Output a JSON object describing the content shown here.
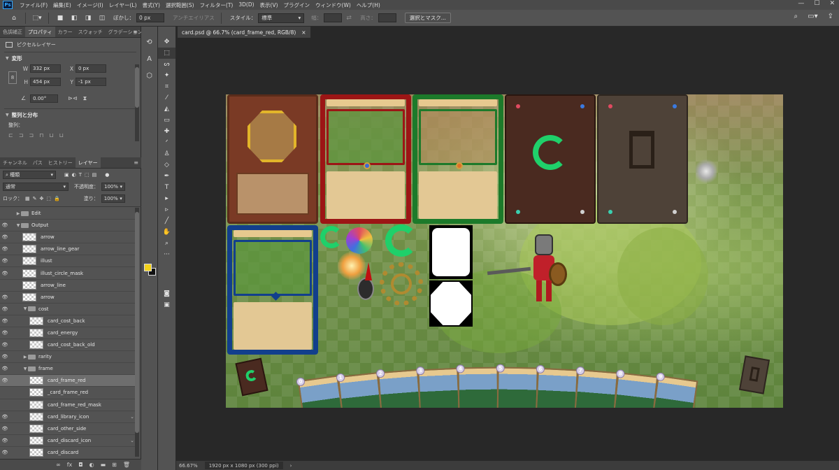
{
  "app": {
    "logo": "Ps"
  },
  "menu": [
    "ファイル(F)",
    "編集(E)",
    "イメージ(I)",
    "レイヤー(L)",
    "書式(Y)",
    "選択範囲(S)",
    "フィルター(T)",
    "3D(D)",
    "表示(V)",
    "プラグイン",
    "ウィンドウ(W)",
    "ヘルプ(H)"
  ],
  "window_controls": {
    "minimize": "—",
    "maximize": "☐",
    "close": "✕"
  },
  "options": {
    "feather_label": "ぼかし：",
    "feather_value": "0 px",
    "antialias_label": "アンチエイリアス",
    "style_label": "スタイル：",
    "style_value": "標準",
    "width_label": "幅：",
    "height_label": "高さ：",
    "select_mask": "選択とマスク..."
  },
  "props_tabs": [
    "色調補正",
    "プロパティ",
    "カラー",
    "スウォッチ",
    "グラデーション",
    "パターン"
  ],
  "properties": {
    "layer_type": "ピクセルレイヤー",
    "transform_title": "変形",
    "w_label": "W",
    "w_value": "332 px",
    "x_label": "X",
    "x_value": "0 px",
    "h_label": "H",
    "h_value": "454 px",
    "y_label": "Y",
    "y_value": "-1 px",
    "angle_value": "0.00°",
    "align_title": "整列と分布",
    "align_label": "整列："
  },
  "layers_tabs": [
    "チャンネル",
    "パス",
    "ヒストリー",
    "レイヤー"
  ],
  "layers_panel": {
    "filter_kind": "種類",
    "blend_mode": "通常",
    "opacity_label": "不透明度：",
    "opacity_value": "100%",
    "lock_label": "ロック：",
    "fill_label": "塗り：",
    "fill_value": "100%"
  },
  "layers": [
    {
      "name": "Edit",
      "kind": "group",
      "depth": 0,
      "visible": false,
      "open": false
    },
    {
      "name": "Output",
      "kind": "group",
      "depth": 0,
      "visible": true,
      "open": true
    },
    {
      "name": "arrow",
      "kind": "layer",
      "depth": 1,
      "visible": true
    },
    {
      "name": "arrow_line_gear",
      "kind": "layer",
      "depth": 1,
      "visible": true
    },
    {
      "name": "illust",
      "kind": "layer",
      "depth": 1,
      "visible": true
    },
    {
      "name": "illust_circle_mask",
      "kind": "layer",
      "depth": 1,
      "visible": true
    },
    {
      "name": "arrow_line",
      "kind": "layer",
      "depth": 1,
      "visible": false
    },
    {
      "name": "arrow",
      "kind": "layer",
      "depth": 1,
      "visible": true
    },
    {
      "name": "cost",
      "kind": "group",
      "depth": 1,
      "visible": true,
      "open": true
    },
    {
      "name": "card_cost_back",
      "kind": "layer",
      "depth": 2,
      "visible": true
    },
    {
      "name": "card_energy",
      "kind": "layer",
      "depth": 2,
      "visible": true
    },
    {
      "name": "card_cost_back_old",
      "kind": "layer",
      "depth": 2,
      "visible": true
    },
    {
      "name": "rarity",
      "kind": "group",
      "depth": 1,
      "visible": true,
      "open": false
    },
    {
      "name": "frame",
      "kind": "group",
      "depth": 1,
      "visible": true,
      "open": true
    },
    {
      "name": "card_frame_red",
      "kind": "layer",
      "depth": 2,
      "visible": true,
      "selected": true
    },
    {
      "name": "_card_frame_red",
      "kind": "layer",
      "depth": 2,
      "visible": false
    },
    {
      "name": "card_frame_red_mask",
      "kind": "layer",
      "depth": 2,
      "visible": false
    },
    {
      "name": "card_library_icon",
      "kind": "layer",
      "depth": 2,
      "visible": true,
      "fx": true
    },
    {
      "name": "card_other_side",
      "kind": "layer",
      "depth": 2,
      "visible": true
    },
    {
      "name": "card_discard_icon",
      "kind": "layer",
      "depth": 2,
      "visible": true,
      "fx": true
    },
    {
      "name": "card_discard",
      "kind": "layer",
      "depth": 2,
      "visible": true
    }
  ],
  "document": {
    "tab_title": "card.psd @ 66.7% (card_frame_red, RGB/8)",
    "tab_close": "×",
    "zoom": "66.67%",
    "doc_size": "1920 px x 1080 px (300 ppi)"
  },
  "canvas": {
    "hand_numbers": [
      "0",
      "1",
      "2",
      "3",
      "4",
      "5",
      "6",
      "7",
      "8",
      "9"
    ],
    "colors": {
      "frame_red": "#9c1515",
      "frame_green": "#1c7a2a",
      "frame_blue": "#123f8c",
      "frame_wood": "#7a3a25",
      "card_back": "#4a2a20",
      "card_back_grey": "#4e4238",
      "spiral": "#1fd06a",
      "foreground": "#f3d21a",
      "background": "#111111"
    }
  }
}
